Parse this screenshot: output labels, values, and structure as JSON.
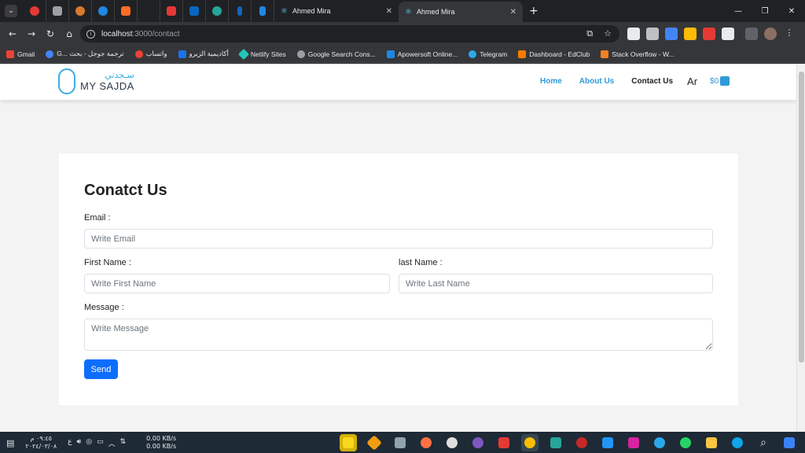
{
  "browser": {
    "tabs": [
      {
        "title": "Ahmed Mira",
        "active": false
      },
      {
        "title": "Ahmed Mira",
        "active": true
      }
    ],
    "new_tab_label": "+",
    "url_host": "localhost",
    "url_path": ":3000/contact",
    "bookmarks": [
      {
        "label": "Gmail",
        "color": "#ea4335"
      },
      {
        "label": "G... ترجمة جوجل - بحث",
        "color": "#4285f4"
      },
      {
        "label": "واتساب",
        "color": "#ea4335"
      },
      {
        "label": "أكاديمية الزيرو",
        "color": "#1a73e8"
      },
      {
        "label": "Netlify Sites",
        "color": "#20c6b7"
      },
      {
        "label": "Google Search Cons...",
        "color": "#9aa0a6"
      },
      {
        "label": "Apowersoft Online...",
        "color": "#1e88e5"
      },
      {
        "label": "Telegram",
        "color": "#29a9eb"
      },
      {
        "label": "Dashboard - EdClub",
        "color": "#f57c00"
      },
      {
        "label": "Stack Overflow - W...",
        "color": "#f48024"
      }
    ]
  },
  "site": {
    "logo_ar": "سـجدتي",
    "logo_en": "MY SAJDA",
    "nav": {
      "home": "Home",
      "about": "About Us",
      "contact": "Contact Us",
      "lang": "Ar",
      "cart_amount": "$0"
    },
    "colors": {
      "accent": "#2f9ad8",
      "button": "#0d6efd"
    }
  },
  "form": {
    "title": "Conatct Us",
    "email_label": "Email :",
    "email_placeholder": "Write Email",
    "first_name_label": "First Name :",
    "first_name_placeholder": "Write First Name",
    "last_name_label": "last Name :",
    "last_name_placeholder": "Write Last Name",
    "message_label": "Message :",
    "message_placeholder": "Write Message",
    "send_label": "Send"
  },
  "taskbar": {
    "time": "٠٩:٤٥ م",
    "date": "٢٠٢٤/٠٣/٠٨",
    "lang_indicator": "ع",
    "upload_speed": "0.00 KB/s",
    "download_speed": "0.00 KB/s"
  }
}
